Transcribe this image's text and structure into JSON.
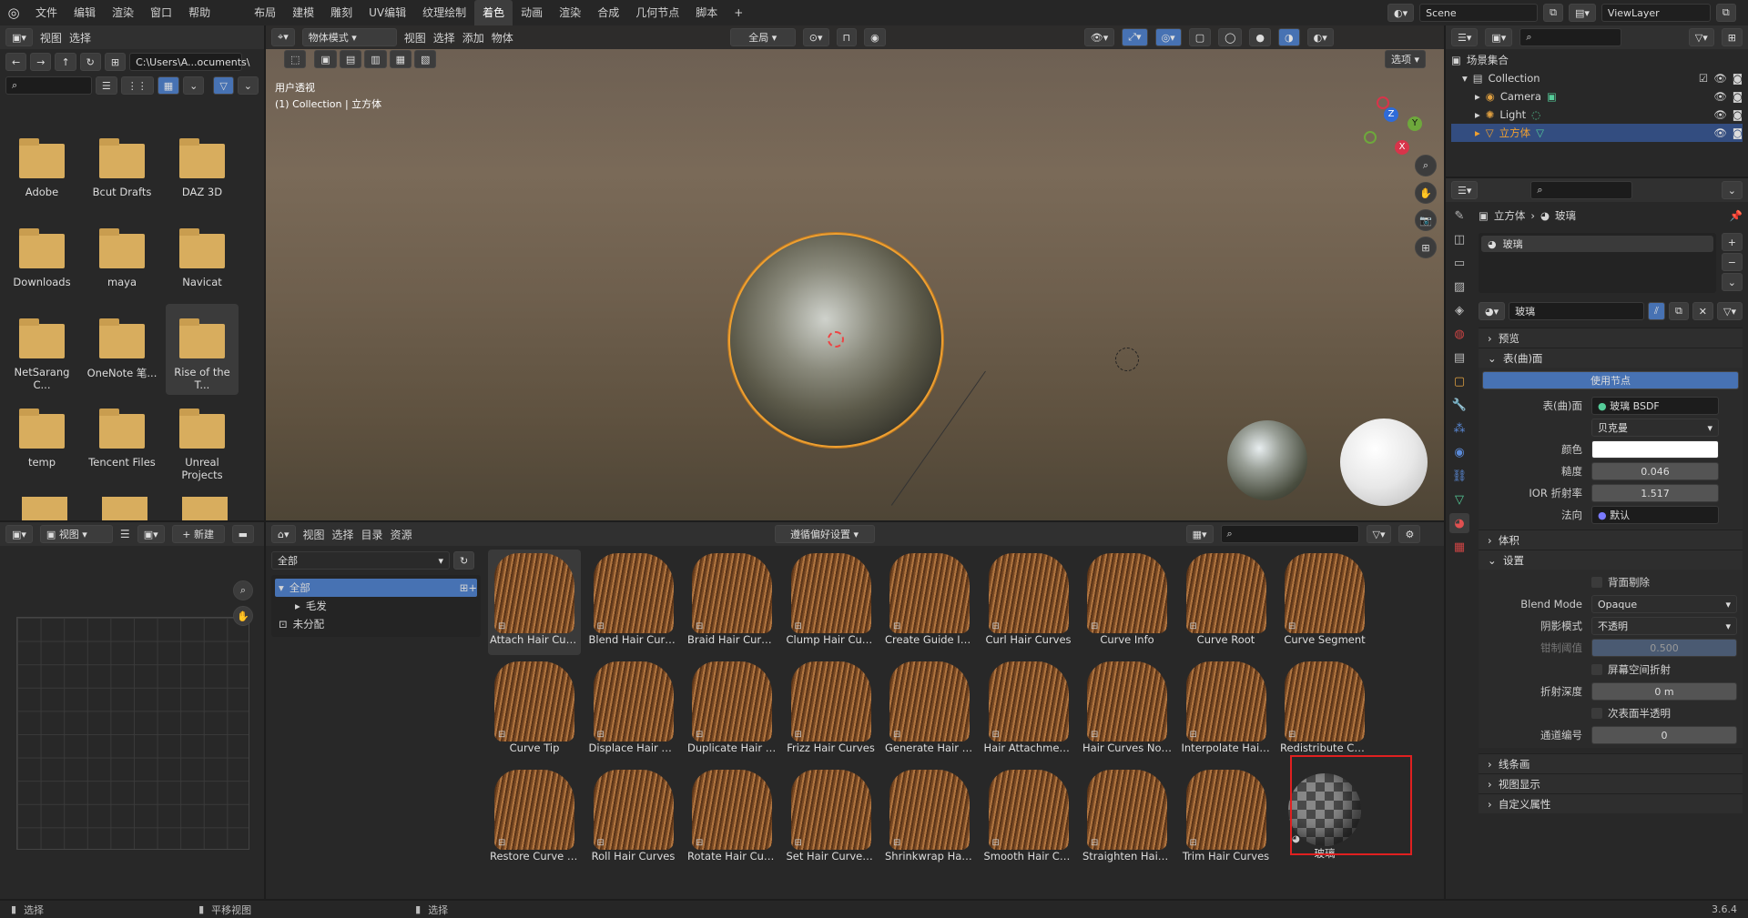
{
  "menu": {
    "items": [
      "文件",
      "编辑",
      "渲染",
      "窗口",
      "帮助"
    ]
  },
  "workspaces": {
    "tabs": [
      "布局",
      "建模",
      "雕刻",
      "UV编辑",
      "纹理绘制",
      "着色",
      "动画",
      "渲染",
      "合成",
      "几何节点",
      "脚本"
    ],
    "active": "着色",
    "add": "+"
  },
  "scene": {
    "name": "Scene",
    "viewlayer": "ViewLayer"
  },
  "filebrowser": {
    "header": {
      "view": "视图",
      "select": "选择"
    },
    "path": "C:\\Users\\A...ocuments\\",
    "folders": [
      "Adobe",
      "Bcut Drafts",
      "DAZ 3D",
      "Downloads",
      "maya",
      "Navicat",
      "NetSarang C...",
      "OneNote 笔...",
      "Rise of the T...",
      "temp",
      "Tencent Files",
      "Unreal Projects"
    ]
  },
  "viewport": {
    "mode": "物体模式",
    "menus": [
      "视图",
      "选择",
      "添加",
      "物体"
    ],
    "transform": "全局",
    "options": "选项",
    "overlay_title": "用户透视",
    "overlay_sub": "(1) Collection | 立方体",
    "gizmo": {
      "z": "Z",
      "y": "Y",
      "x": "X"
    }
  },
  "imageeditor": {
    "view": "视图",
    "new": "新建"
  },
  "assetbrowser": {
    "menus": [
      "视图",
      "选择",
      "目录",
      "资源"
    ],
    "library": "遵循偏好设置",
    "catalog_dropdown": "全部",
    "tree": {
      "all": "全部",
      "hair": "毛发",
      "unassigned": "未分配"
    },
    "assets": [
      "Attach Hair Curve...",
      "Blend Hair Curves",
      "Braid Hair Curves",
      "Clump Hair Curves",
      "Create Guide Inde...",
      "Curl Hair Curves",
      "Curve Info",
      "Curve Root",
      "Curve Segment",
      "Curve Tip",
      "Displace Hair Cur...",
      "Duplicate Hair Cu...",
      "Frizz Hair Curves",
      "Generate Hair Cur...",
      "Hair Attachment I...",
      "Hair Curves Noise",
      "Interpolate Hair C...",
      "Redistribute Curv...",
      "Restore Curve Se...",
      "Roll Hair Curves",
      "Rotate Hair Curves",
      "Set Hair Curve Pr...",
      "Shrinkwrap Hair C...",
      "Smooth Hair Curves",
      "Straighten Hair C...",
      "Trim Hair Curves",
      "玻璃"
    ]
  },
  "outliner": {
    "title": "场景集合",
    "collection": "Collection",
    "items": [
      "Camera",
      "Light",
      "立方体"
    ]
  },
  "properties": {
    "breadcrumb": [
      "立方体",
      "玻璃"
    ],
    "slot": "玻璃",
    "material": "玻璃",
    "sections": {
      "preview": "预览",
      "surface": "表(曲)面",
      "volume": "体积",
      "settings": "设置",
      "lineart": "线条画",
      "viewport": "视图显示",
      "custom": "自定义属性"
    },
    "use_nodes": "使用节点",
    "surface_label": "表(曲)面",
    "surface_value": "玻璃 BSDF",
    "distribution": "贝克曼",
    "color_label": "颜色",
    "roughness_label": "糙度",
    "roughness": "0.046",
    "ior_label": "IOR 折射率",
    "ior": "1.517",
    "normal_label": "法向",
    "normal": "默认",
    "backface": "背面剔除",
    "blend_label": "Blend Mode",
    "blend": "Opaque",
    "shadow_label": "阴影模式",
    "shadow": "不透明",
    "clip_label": "钳制阈值",
    "clip": "0.500",
    "ssr": "屏幕空间折射",
    "refr_depth_label": "折射深度",
    "refr_depth": "0 m",
    "sss": "次表面半透明",
    "pass_label": "通道编号",
    "pass": "0"
  },
  "status": {
    "select1": "选择",
    "pan": "平移视图",
    "select2": "选择",
    "version": "3.6.4"
  },
  "colors": {
    "accent": "#4772b3",
    "selection_orange": "#f0a030",
    "highlight_red": "#e02020",
    "folder": "#d8ad5e"
  }
}
